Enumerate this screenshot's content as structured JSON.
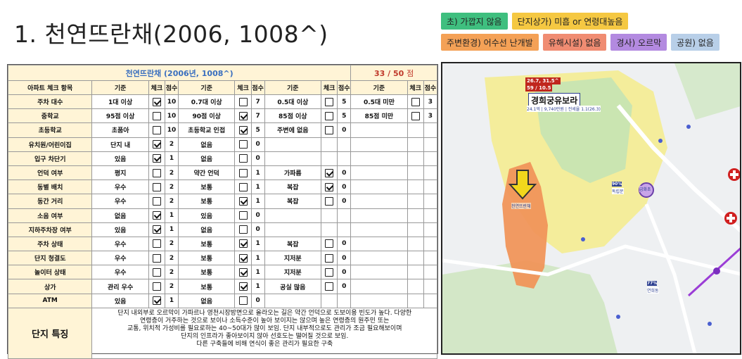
{
  "title": "1. 천연뜨란채(2006, 1008^)",
  "tags": [
    [
      {
        "label": "초) 가깝지 않음",
        "color": "#3fbf7f"
      },
      {
        "label": "단지상가) 미흡 or 연령대높음",
        "color": "#f5c842"
      }
    ],
    [
      {
        "label": "주변환경) 어수선 난개발",
        "color": "#f4a156"
      },
      {
        "label": "유해시설) 없음",
        "color": "#f08c72"
      },
      {
        "label": "경사) 오르막",
        "color": "#b38ae0"
      },
      {
        "label": "공원) 없음",
        "color": "#b8cfe8"
      }
    ]
  ],
  "sheet": {
    "title": "천연뜨란채 (2006년, 1008^)",
    "score": "33 / 50",
    "score_unit": "점",
    "headers": [
      "아파트 체크 항목",
      "기준",
      "체크",
      "점수",
      "기준",
      "체크",
      "점수",
      "기준",
      "체크",
      "점수",
      "기준",
      "체크",
      "점수"
    ],
    "rows": [
      {
        "label": "주차 대수",
        "cells": [
          [
            "1대 이상",
            true,
            "10"
          ],
          [
            "0.7대 이상",
            false,
            "7"
          ],
          [
            "0.5대 이상",
            false,
            "5"
          ],
          [
            "0.5대 미만",
            false,
            "3"
          ]
        ]
      },
      {
        "label": "중학교",
        "cells": [
          [
            "95점 이상",
            false,
            "10"
          ],
          [
            "90점 이상",
            true,
            "7"
          ],
          [
            "85점 이상",
            false,
            "5"
          ],
          [
            "85점 미만",
            false,
            "3"
          ]
        ]
      },
      {
        "label": "초등학교",
        "cells": [
          [
            "초품아",
            false,
            "10"
          ],
          [
            "초등학교 인접",
            true,
            "5"
          ],
          [
            "주변에 없음",
            false,
            "0"
          ],
          null
        ]
      },
      {
        "label": "유치원/어린이집",
        "cells": [
          [
            "단지 내",
            true,
            "2"
          ],
          [
            "없음",
            false,
            "0"
          ],
          null,
          null
        ]
      },
      {
        "label": "입구 차단기",
        "cells": [
          [
            "있음",
            true,
            "1"
          ],
          [
            "없음",
            false,
            "0"
          ],
          null,
          null
        ]
      },
      {
        "label": "언덕 여부",
        "cells": [
          [
            "평지",
            false,
            "2"
          ],
          [
            "약간 언덕",
            false,
            "1"
          ],
          [
            "가파름",
            true,
            "0"
          ],
          null
        ]
      },
      {
        "label": "동별 배치",
        "cells": [
          [
            "우수",
            false,
            "2"
          ],
          [
            "보통",
            false,
            "1"
          ],
          [
            "복잡",
            true,
            "0"
          ],
          null
        ]
      },
      {
        "label": "동간 거리",
        "cells": [
          [
            "우수",
            false,
            "2"
          ],
          [
            "보통",
            true,
            "1"
          ],
          [
            "복잡",
            false,
            "0"
          ],
          null
        ]
      },
      {
        "label": "소음 여부",
        "cells": [
          [
            "없음",
            true,
            "1"
          ],
          [
            "있음",
            false,
            "0"
          ],
          null,
          null
        ]
      },
      {
        "label": "지하주차장 여부",
        "cells": [
          [
            "있음",
            true,
            "1"
          ],
          [
            "없음",
            false,
            "0"
          ],
          null,
          null
        ]
      },
      {
        "label": "주차 상태",
        "cells": [
          [
            "우수",
            false,
            "2"
          ],
          [
            "보통",
            true,
            "1"
          ],
          [
            "복잡",
            false,
            "0"
          ],
          null
        ]
      },
      {
        "label": "단지 청결도",
        "cells": [
          [
            "우수",
            false,
            "2"
          ],
          [
            "보통",
            true,
            "1"
          ],
          [
            "지저분",
            false,
            "0"
          ],
          null
        ]
      },
      {
        "label": "놀이터 상태",
        "cells": [
          [
            "우수",
            false,
            "2"
          ],
          [
            "보통",
            true,
            "1"
          ],
          [
            "지저분",
            false,
            "0"
          ],
          null
        ]
      },
      {
        "label": "상가",
        "cells": [
          [
            "관리 우수",
            false,
            "2"
          ],
          [
            "보통",
            true,
            "1"
          ],
          [
            "공실 많음",
            false,
            "0"
          ],
          null
        ]
      },
      {
        "label": "ATM",
        "cells": [
          [
            "있음",
            true,
            "1"
          ],
          [
            "없음",
            false,
            "0"
          ],
          null,
          null
        ]
      }
    ],
    "feature_label": "단지 특징",
    "feature_text": [
      "단지 내외부로 오르막이 가파르나 영천시장방면으로 올라오는 길은 약간 언덕으로 도보이용 빈도가 높다. 다양한",
      "연령층이 거주하는 것으로 보이나 소득수준이 높아 보이지는 않으며 높은 연령층의 원주민 또는",
      "교통, 위치적 가성비를 필요로하는 40~50대가 많이 보임. 단지 내부적으로도 관리가 조금 필요해보이며",
      "단지의 인프라가 좋아보이지 않아 선호도는 떨어질 것으로 보임.",
      "다른 구축들에 비해 연식이 좋은 관리가 필요한 구축"
    ]
  },
  "map": {
    "price_tag_1": "26.7, 31.5^",
    "price_tag_2": "59 / 10.5",
    "main_label": "경희궁유보라",
    "main_sub": "24.1억 | 9,740만원 | 전세율 1.1(26.3)",
    "pin_label": "천연뜨란채",
    "badge1_pct": "90%",
    "badge1_name": "독립문",
    "badge2_pct": "77%",
    "badge2_name": "연희동",
    "purple_badge": "금화초"
  }
}
